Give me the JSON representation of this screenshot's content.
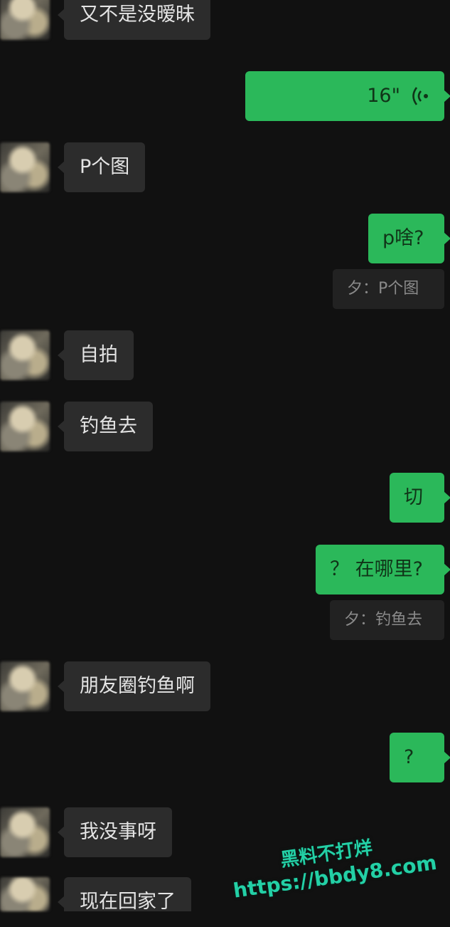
{
  "messages": [
    {
      "side": "left",
      "text": "又不是没暧昧"
    },
    {
      "side": "right",
      "type": "voice",
      "duration": "16\""
    },
    {
      "side": "left",
      "text": "P个图"
    },
    {
      "side": "right",
      "text": "p啥?",
      "quote": "夕：P个图"
    },
    {
      "side": "left",
      "text": "自拍"
    },
    {
      "side": "left",
      "text": "钓鱼去"
    },
    {
      "side": "right",
      "text": "切"
    },
    {
      "side": "right",
      "text": "？ 在哪里?",
      "quote": "夕：钓鱼去"
    },
    {
      "side": "left",
      "text": "朋友圈钓鱼啊"
    },
    {
      "side": "right",
      "text": "?"
    },
    {
      "side": "left",
      "text": "我没事呀"
    },
    {
      "side": "left",
      "text": "现在回家了"
    }
  ],
  "watermark": {
    "line1": "黑料不打烊",
    "line2": "https://bbdy8.com"
  },
  "colors": {
    "background": "#111111",
    "sent_bubble": "#2bb85a",
    "received_bubble": "#2c2c2c",
    "watermark": "#23d0a6"
  }
}
